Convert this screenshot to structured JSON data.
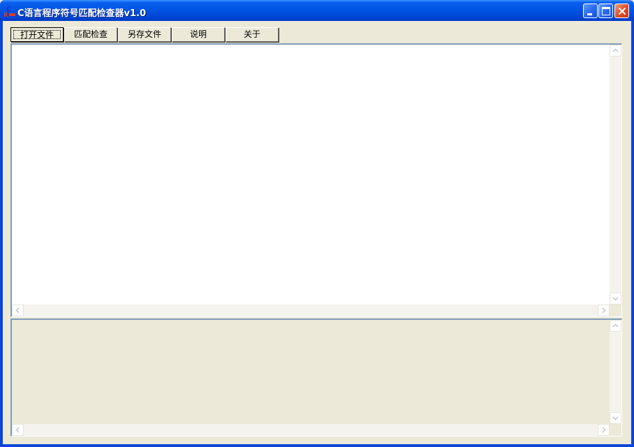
{
  "window": {
    "title": "C语言程序符号匹配检查器v1.0",
    "icon": "c-language-app-icon"
  },
  "titlebar_buttons": {
    "minimize": "minimize-icon",
    "maximize": "maximize-icon",
    "close": "close-icon"
  },
  "toolbar": {
    "open_file": "打开文件",
    "match_check": "匹配检查",
    "save_as": "另存文件",
    "help": "说明",
    "about": "关于"
  },
  "editor": {
    "value": ""
  },
  "output": {
    "value": ""
  },
  "colors": {
    "titlebar": "#0055e5",
    "client_background": "#ece9d8",
    "pane_border": "#7f9db9",
    "close_button": "#e0502a"
  }
}
